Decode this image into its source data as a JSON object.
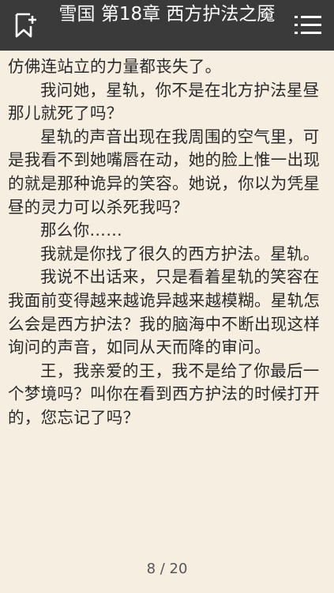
{
  "header": {
    "title": "雪国 第18章 西方护法之魇",
    "bookmark_icon": "bookmark-add-icon",
    "menu_icon": "list-menu-icon"
  },
  "reader": {
    "paragraphs": [
      "仿佛连站立的力量都丧失了。",
      "我问她，星轨，你不是在北方护法星昼那儿就死了吗？",
      "星轨的声音出现在我周围的空气里，可是我看不到她嘴唇在动，她的脸上惟一出现的就是那种诡异的笑容。她说，你以为凭星昼的灵力可以杀死我吗？",
      "那么你……",
      "我就是你找了很久的西方护法。星轨。",
      "我说不出话来，只是看着星轨的笑容在我面前变得越来越诡异越来越模糊。星轨怎么会是西方护法？我的脑海中不断出现这样询问的声音，如同从天而降的审问。",
      "王，我亲爱的王，我不是给了你最后一个梦境吗？叫你在看到西方护法的时候打开的，您忘记了吗？"
    ]
  },
  "pager": {
    "text": "8 / 20"
  },
  "colors": {
    "topbar": "#3a3a3a",
    "page_background": "#f6eee1",
    "text": "#2a2a2a"
  }
}
